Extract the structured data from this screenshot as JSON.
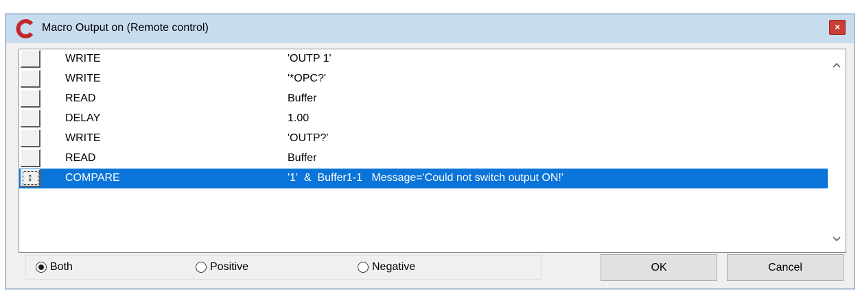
{
  "window": {
    "title": "Macro Output on (Remote control)",
    "close_label": "×"
  },
  "list": {
    "rows": [
      {
        "command": "WRITE",
        "argument": "'OUTP 1'",
        "selected": false
      },
      {
        "command": "WRITE",
        "argument": "'*OPC?'",
        "selected": false
      },
      {
        "command": "READ",
        "argument": "Buffer",
        "selected": false
      },
      {
        "command": "DELAY",
        "argument": "1.00",
        "selected": false
      },
      {
        "command": "WRITE",
        "argument": "'OUTP?'",
        "selected": false
      },
      {
        "command": "READ",
        "argument": "Buffer",
        "selected": false
      },
      {
        "command": "COMPARE",
        "argument": "'1'  &  Buffer1-1   Message='Could not switch output ON!'",
        "selected": true
      }
    ],
    "selected_handle_glyph": "↕",
    "scroll_up_icon": "chevron-up-icon",
    "scroll_down_icon": "chevron-down-icon"
  },
  "filter": {
    "options": [
      {
        "label": "Both",
        "checked": true
      },
      {
        "label": "Positive",
        "checked": false
      },
      {
        "label": "Negative",
        "checked": false
      }
    ]
  },
  "buttons": {
    "ok_label": "OK",
    "cancel_label": "Cancel"
  },
  "colors": {
    "selection": "#0a74d8",
    "titlebar": "#c8dcf0",
    "close_button": "#c84035",
    "app_icon": "#c0282d"
  }
}
